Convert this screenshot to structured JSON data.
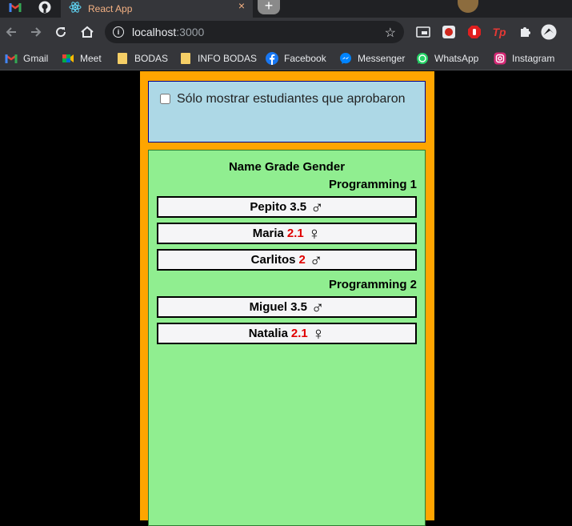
{
  "browser": {
    "tab": {
      "title": "React App",
      "close": "×"
    },
    "new_tab": "+",
    "address": {
      "host": "localhost",
      "port": ":3000",
      "star": "☆"
    },
    "bookmarks": [
      {
        "label": "Gmail",
        "icon": "gmail-icon"
      },
      {
        "label": "Meet",
        "icon": "meet-icon"
      },
      {
        "label": "BODAS",
        "icon": "folder-icon"
      },
      {
        "label": "INFO BODAS",
        "icon": "folder-icon"
      },
      {
        "label": "Facebook",
        "icon": "facebook-icon"
      },
      {
        "label": "Messenger",
        "icon": "messenger-icon"
      },
      {
        "label": "WhatsApp",
        "icon": "whatsapp-icon"
      },
      {
        "label": "Instagram",
        "icon": "instagram-icon"
      }
    ]
  },
  "filter": {
    "label": "Sólo mostrar estudiantes que aprobaron",
    "checked": false
  },
  "table": {
    "header": "Name Grade Gender",
    "courses": [
      {
        "name": "Programming 1",
        "students": [
          {
            "name": "Pepito",
            "grade": "3.5",
            "passed": true,
            "gender": "♂"
          },
          {
            "name": "Maria",
            "grade": "2.1",
            "passed": false,
            "gender": "♀"
          },
          {
            "name": "Carlitos",
            "grade": "2",
            "passed": false,
            "gender": "♂"
          }
        ]
      },
      {
        "name": "Programming 2",
        "students": [
          {
            "name": "Miguel",
            "grade": "3.5",
            "passed": true,
            "gender": "♂"
          },
          {
            "name": "Natalia",
            "grade": "2.1",
            "passed": false,
            "gender": "♀"
          }
        ]
      }
    ]
  },
  "colors": {
    "fail": "#e00000",
    "panel": "#ffa500",
    "filter_bg": "#add8e6",
    "table_bg": "#90ee90"
  }
}
